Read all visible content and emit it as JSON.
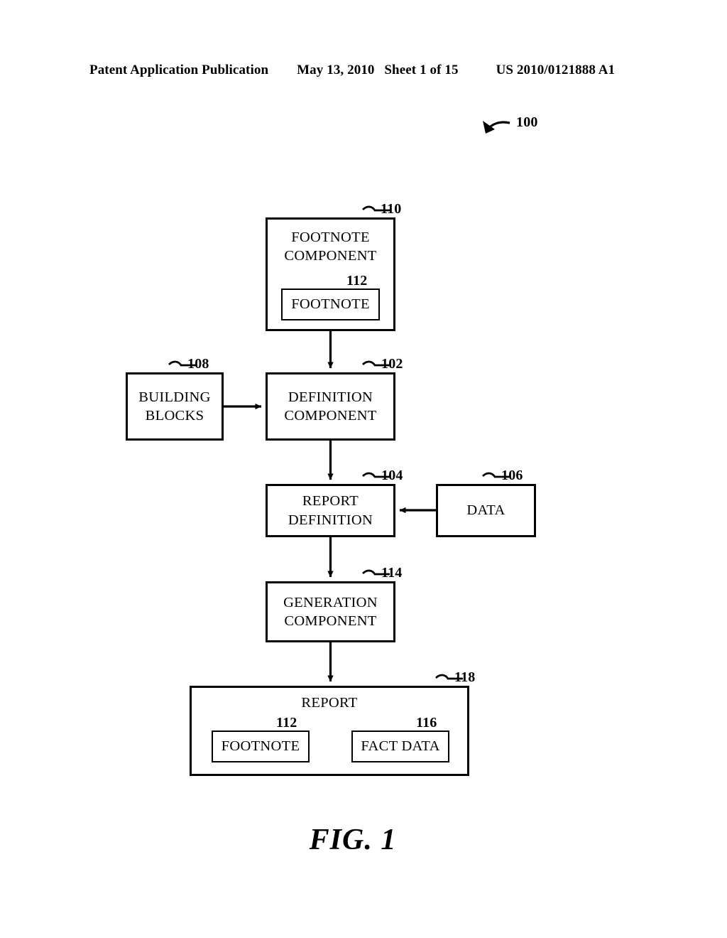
{
  "header": {
    "publication": "Patent Application Publication",
    "date": "May 13, 2010",
    "sheet": "Sheet 1 of 15",
    "patent_number": "US 2010/0121888 A1"
  },
  "figure": {
    "caption": "FIG. 1",
    "system_ref": "100"
  },
  "nodes": [
    {
      "id": "footnote-component",
      "label": "FOOTNOTE\nCOMPONENT",
      "ref": "110"
    },
    {
      "id": "footnote-inner",
      "label": "FOOTNOTE",
      "ref": "112"
    },
    {
      "id": "building-blocks",
      "label": "BUILDING\nBLOCKS",
      "ref": "108"
    },
    {
      "id": "definition-component",
      "label": "DEFINITION\nCOMPONENT",
      "ref": "102"
    },
    {
      "id": "report-definition",
      "label": "REPORT\nDEFINITION",
      "ref": "104"
    },
    {
      "id": "data",
      "label": "DATA",
      "ref": "106"
    },
    {
      "id": "generation-component",
      "label": "GENERATION\nCOMPONENT",
      "ref": "114"
    },
    {
      "id": "report",
      "label": "REPORT",
      "ref": "118"
    },
    {
      "id": "report-footnote",
      "label": "FOOTNOTE",
      "ref": "112"
    },
    {
      "id": "fact-data",
      "label": "FACT DATA",
      "ref": "116"
    }
  ],
  "connections": [
    {
      "from": "footnote-component",
      "to": "definition-component",
      "type": "arrow-down"
    },
    {
      "from": "building-blocks",
      "to": "definition-component",
      "type": "arrow-right"
    },
    {
      "from": "definition-component",
      "to": "report-definition",
      "type": "arrow-down"
    },
    {
      "from": "data",
      "to": "report-definition",
      "type": "arrow-left"
    },
    {
      "from": "report-definition",
      "to": "generation-component",
      "type": "arrow-down"
    },
    {
      "from": "generation-component",
      "to": "report",
      "type": "arrow-down"
    },
    {
      "from": "report-footnote",
      "to": "fact-data",
      "type": "arrow-bidirectional"
    }
  ],
  "colors": {
    "ink": "#000000",
    "paper": "#ffffff"
  }
}
